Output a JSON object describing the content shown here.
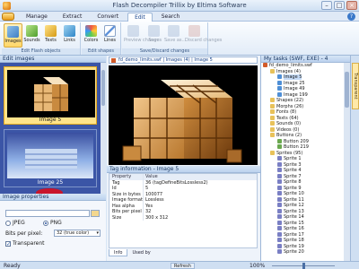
{
  "app": {
    "title": "Flash Decompiler Trillix by Eltima Software",
    "colors": {
      "ribbon": "#e2ecf8",
      "selection": "#ffd76a",
      "thumb_panel": "#3b55a6"
    }
  },
  "menu": {
    "tabs": [
      "Manage",
      "Extract",
      "Convert",
      "Edit",
      "Search"
    ],
    "active_tab": "Edit",
    "help_icon": "question-icon"
  },
  "ribbon": {
    "groups": [
      {
        "label": "Edit Flash objects",
        "buttons": [
          "Images",
          "Sounds",
          "Texts",
          "Links"
        ]
      },
      {
        "label": "Edit shapes",
        "buttons": [
          "Colors",
          "Lines"
        ]
      },
      {
        "label": "Save/Discard changes",
        "buttons": [
          "Preview changes",
          "Save",
          "Save as...",
          "Discard changes"
        ]
      }
    ],
    "selected_button": "Images"
  },
  "left": {
    "header": "Edit images",
    "thumbnails": [
      "Image 5",
      "Image 25"
    ],
    "properties": {
      "header": "Image properties",
      "format_options": [
        "JPEG",
        "PNG"
      ],
      "selected_format": "PNG",
      "bits_label": "Bits per pixel:",
      "bits_value": "32 (true color)",
      "transparent_label": "Transparent",
      "transparent_checked": true
    }
  },
  "center": {
    "doc_tab": "fd_demo_limits.swf | Images (4) | Image 5",
    "tag_header": "Tag information - Image 5",
    "table_headers": [
      "Property",
      "Value"
    ],
    "table_rows": [
      [
        "Tag",
        "36 (tagDefineBitsLossless2)"
      ],
      [
        "Id",
        "5"
      ],
      [
        "Size in bytes",
        "100077"
      ],
      [
        "Image format",
        "Lossless"
      ],
      [
        "Has alpha",
        "Yes"
      ],
      [
        "Bits per pixel",
        "32"
      ],
      [
        "Size",
        "300 x 312"
      ]
    ],
    "bottom_tabs": [
      "Info",
      "Used by"
    ],
    "active_bottom_tab": "Info"
  },
  "right": {
    "header": "My tasks (SWF, EXE) - 4",
    "side_tab": "Transparent",
    "tree": [
      {
        "label": "fd_demo_limits.swf",
        "level": 0,
        "icon": "file-icon"
      },
      {
        "label": "Images (4)",
        "level": 1,
        "icon": "folder-icon"
      },
      {
        "label": "Image 5",
        "level": 2,
        "icon": "image-icon",
        "selected": true
      },
      {
        "label": "Image 25",
        "level": 2,
        "icon": "image-icon"
      },
      {
        "label": "Image 49",
        "level": 2,
        "icon": "image-icon"
      },
      {
        "label": "Image 199",
        "level": 2,
        "icon": "image-icon"
      },
      {
        "label": "Shapes (22)",
        "level": 1,
        "icon": "folder-icon"
      },
      {
        "label": "Morphs (26)",
        "level": 1,
        "icon": "folder-icon"
      },
      {
        "label": "Fonts (8)",
        "level": 1,
        "icon": "folder-icon"
      },
      {
        "label": "Texts (64)",
        "level": 1,
        "icon": "folder-icon"
      },
      {
        "label": "Sounds (0)",
        "level": 1,
        "icon": "folder-icon"
      },
      {
        "label": "Videos (0)",
        "level": 1,
        "icon": "folder-icon"
      },
      {
        "label": "Buttons (2)",
        "level": 1,
        "icon": "folder-icon"
      },
      {
        "label": "Button 209",
        "level": 2,
        "icon": "button-icon"
      },
      {
        "label": "Button 219",
        "level": 2,
        "icon": "button-icon"
      },
      {
        "label": "Sprites (95)",
        "level": 1,
        "icon": "folder-icon"
      },
      {
        "label": "Sprite 1",
        "level": 2,
        "icon": "sprite-icon"
      },
      {
        "label": "Sprite 3",
        "level": 2,
        "icon": "sprite-icon"
      },
      {
        "label": "Sprite 4",
        "level": 2,
        "icon": "sprite-icon"
      },
      {
        "label": "Sprite 7",
        "level": 2,
        "icon": "sprite-icon"
      },
      {
        "label": "Sprite 8",
        "level": 2,
        "icon": "sprite-icon"
      },
      {
        "label": "Sprite 9",
        "level": 2,
        "icon": "sprite-icon"
      },
      {
        "label": "Sprite 10",
        "level": 2,
        "icon": "sprite-icon"
      },
      {
        "label": "Sprite 11",
        "level": 2,
        "icon": "sprite-icon"
      },
      {
        "label": "Sprite 12",
        "level": 2,
        "icon": "sprite-icon"
      },
      {
        "label": "Sprite 13",
        "level": 2,
        "icon": "sprite-icon"
      },
      {
        "label": "Sprite 14",
        "level": 2,
        "icon": "sprite-icon"
      },
      {
        "label": "Sprite 15",
        "level": 2,
        "icon": "sprite-icon"
      },
      {
        "label": "Sprite 16",
        "level": 2,
        "icon": "sprite-icon"
      },
      {
        "label": "Sprite 17",
        "level": 2,
        "icon": "sprite-icon"
      },
      {
        "label": "Sprite 18",
        "level": 2,
        "icon": "sprite-icon"
      },
      {
        "label": "Sprite 19",
        "level": 2,
        "icon": "sprite-icon"
      },
      {
        "label": "Sprite 20",
        "level": 2,
        "icon": "sprite-icon"
      }
    ]
  },
  "status": {
    "text": "Ready",
    "refresh_label": "Refresh",
    "zoom": "100%",
    "zoom_fraction": 0.5
  }
}
